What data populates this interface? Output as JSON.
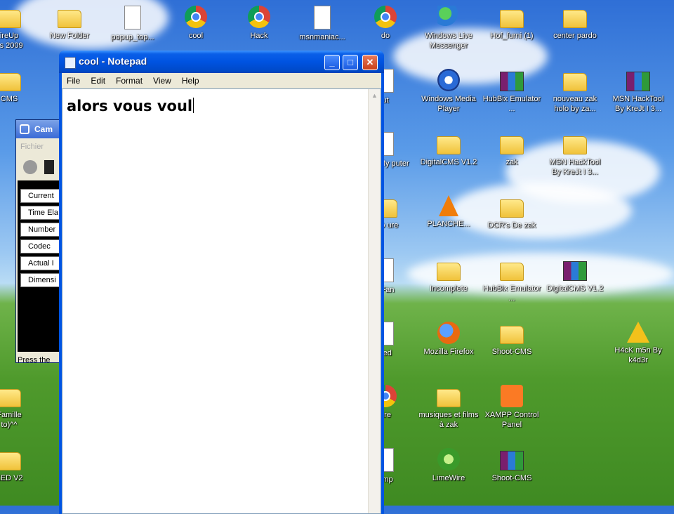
{
  "desktop": {
    "icons": [
      {
        "label": "ireUp\nes 2009",
        "type": "folder"
      },
      {
        "label": "New Folder",
        "type": "folder"
      },
      {
        "label": "popup_top...",
        "type": "doc"
      },
      {
        "label": "cool",
        "type": "chrome"
      },
      {
        "label": "Hack",
        "type": "chrome"
      },
      {
        "label": "msnmaniac...",
        "type": "doc"
      },
      {
        "label": "do",
        "type": "chrome"
      },
      {
        "label": "Windows Live Messenger",
        "type": "msn"
      },
      {
        "label": "Hof_furni (1)",
        "type": "folder"
      },
      {
        "label": "center pardo",
        "type": "folder"
      },
      {
        "label": "CMS",
        "type": "folder"
      },
      {
        "label": "ut",
        "type": "doc"
      },
      {
        "label": "Windows Media Player",
        "type": "wmp"
      },
      {
        "label": "HubBix Emulator ...",
        "type": "rar"
      },
      {
        "label": "nouveau zak holo by za...",
        "type": "folder"
      },
      {
        "label": "MSN HackTool By KreJt I 3...",
        "type": "rar"
      },
      {
        "label": "ut to My puter",
        "type": "doc"
      },
      {
        "label": "DigitalCMS V1.2",
        "type": "folder"
      },
      {
        "label": "zak",
        "type": "folder"
      },
      {
        "label": "MSN HackTool By KreJt I 3...",
        "type": "folder"
      },
      {
        "label": "ioto ure",
        "type": "folder"
      },
      {
        "label": "PLANCHE...",
        "type": "vlc"
      },
      {
        "label": "DCR's De zak",
        "type": "folder"
      },
      {
        "label": "dFan",
        "type": "doc"
      },
      {
        "label": "Incomplete",
        "type": "folder"
      },
      {
        "label": "HubBix Emulator ...",
        "type": "folder"
      },
      {
        "label": "DigitalCMS V1.2",
        "type": "rar"
      },
      {
        "label": "tled",
        "type": "doc"
      },
      {
        "label": "Mozilla Firefox",
        "type": "ff"
      },
      {
        "label": "Shoot-CMS",
        "type": "folder"
      },
      {
        "label": "H4cK m5n By k4d3r",
        "type": "warn"
      },
      {
        "label": "Famille\nto)^^",
        "type": "folder"
      },
      {
        "label": "ure",
        "type": "chrome"
      },
      {
        "label": "musiques et films à zak",
        "type": "folder"
      },
      {
        "label": "XAMPP Control Panel",
        "type": "xampp"
      },
      {
        "label": "KED V2",
        "type": "folder"
      },
      {
        "label": "amp",
        "type": "doc"
      },
      {
        "label": "LimeWire",
        "type": "lime"
      },
      {
        "label": "Shoot-CMS",
        "type": "rar"
      }
    ]
  },
  "camtasia": {
    "title": "Cam",
    "menu": "Fichier",
    "stats": [
      "Current",
      "Time Ela",
      "Number",
      "Codec",
      "Actual I",
      "Dimensi"
    ],
    "status": "Press the"
  },
  "notepad": {
    "title": "cool - Notepad",
    "menu": [
      "File",
      "Edit",
      "Format",
      "View",
      "Help"
    ],
    "content": "alors vous voul",
    "min_glyph": "_",
    "max_glyph": "□",
    "close_glyph": "✕"
  },
  "colors": {
    "titlebar": "#0054e3",
    "close_button": "#c8401a",
    "menubar": "#ece9d8"
  }
}
